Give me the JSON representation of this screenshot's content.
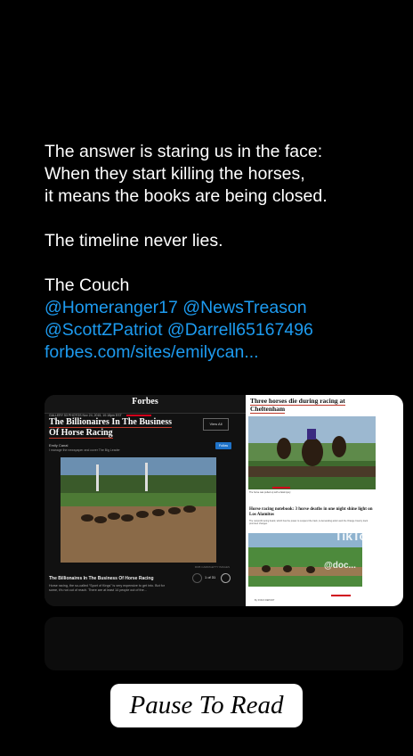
{
  "post": {
    "line1": "The answer is staring us in the face:",
    "line2": "When they start killing the horses,",
    "line3": "it means the books are being closed.",
    "line4": "The timeline never lies.",
    "line5": "The Couch",
    "mentions1": "@Homeranger17 @NewsTreason",
    "mentions2": "@ScottZPatriot @Darrell65167496",
    "link": "forbes.com/sites/emilycan..."
  },
  "forbes": {
    "logo": "Forbes",
    "meta": "GALLERY  53 PHOTOS  Nov 24, 2015, 10:18pm EST",
    "title": "The Billionaires In The Business Of Horse Racing",
    "author": "Emily Canal",
    "subtitle": "I manage the newspaper and cover The Big Leader",
    "view_all": "View All",
    "follow": "Follow",
    "caption_title": "The Billionaires In The Business Of Horse Racing",
    "caption_text": "Horse racing, the so-called “Sport of Kings” is very expensive to get into. But for some, it’s not out of reach. There are at least 14 people out of the...",
    "pager": "1 of 31",
    "credit": "ROB CARR/GETTY IMAGES"
  },
  "right_article": {
    "title": "Three horses die during racing at Cheltenham",
    "photo_caption": "The horse was pulled up with a fatal injury",
    "headline2": "Horse racing notebook: 3 horse deaths in one night shine light on Los Alamitos",
    "body2": "The nonprofit racing board, which has the power to suspend the track, is demanding action and the Orange County track promises changes",
    "byline": "By STAFF REPORT"
  },
  "overlay": {
    "tiktok": "TikTok",
    "username": "@doc..."
  },
  "sticker": {
    "label": "Pause To Read"
  },
  "colors": {
    "background": "#000000",
    "link": "#1d9bf0",
    "arrow": "#d0021b"
  }
}
